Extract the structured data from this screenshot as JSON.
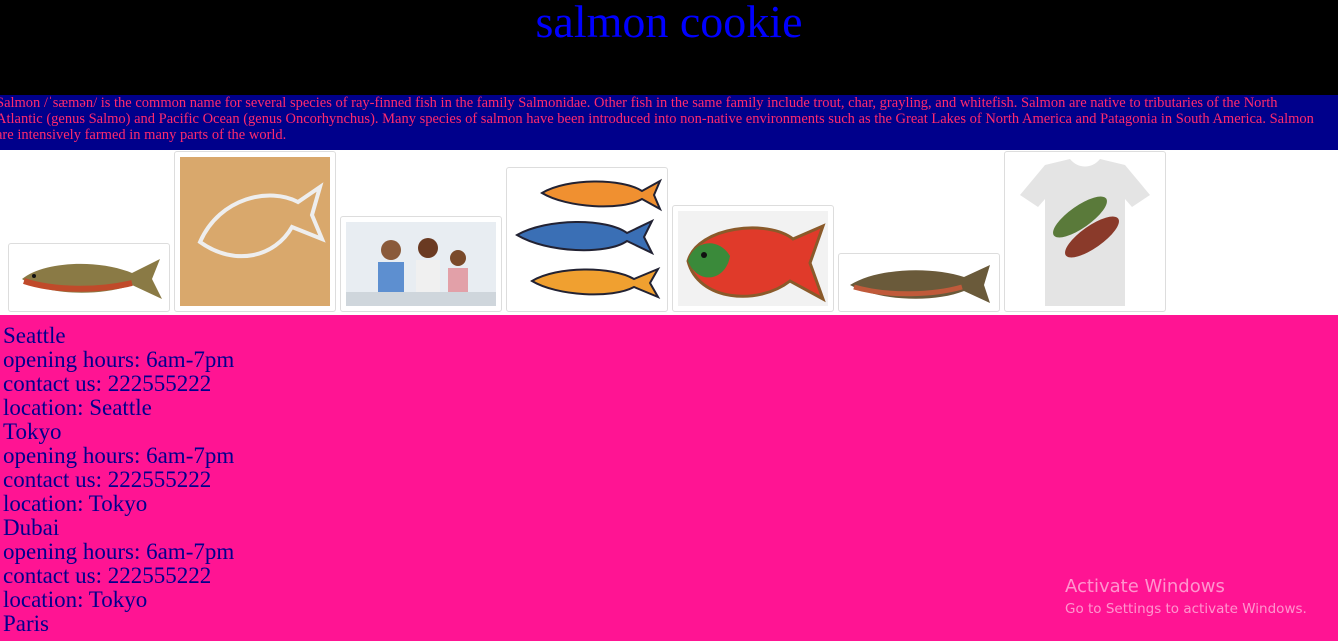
{
  "header": {
    "title": "salmon cookie"
  },
  "intro": {
    "text": "Salmon /ˈsæmən/ is the common name for several species of ray-finned fish in the family Salmonidae. Other fish in the same family include trout, char, grayling, and whitefish. Salmon are native to tributaries of the North Atlantic (genus Salmo) and Pacific Ocean (genus Oncorhynchus). Many species of salmon have been introduced into non-native environments such as the Great Lakes of North America and Patagonia in South America. Salmon are intensively farmed in many parts of the world."
  },
  "gallery": {
    "images": [
      {
        "icon": "salmon-fish-image"
      },
      {
        "icon": "salmon-cookie-cutter-image"
      },
      {
        "icon": "family-kitchen-image"
      },
      {
        "icon": "cartoon-fish-image"
      },
      {
        "icon": "salmon-cookie-image"
      },
      {
        "icon": "salmon-side-image"
      },
      {
        "icon": "salmon-tshirt-image"
      }
    ]
  },
  "stores": [
    {
      "name": "Seattle",
      "hours": "opening hours: 6am-7pm",
      "contact": "contact us: 222555222",
      "location": "location: Seattle"
    },
    {
      "name": "Tokyo",
      "hours": "opening hours: 6am-7pm",
      "contact": "contact us: 222555222",
      "location": "location: Tokyo"
    },
    {
      "name": "Dubai",
      "hours": "opening hours: 6am-7pm",
      "contact": "contact us: 222555222",
      "location": "location: Tokyo"
    },
    {
      "name": "Paris"
    }
  ],
  "watermark": {
    "title": "Activate Windows",
    "subtitle": "Go to Settings to activate Windows."
  },
  "colors": {
    "header_bg": "#000000",
    "title": "#0000ff",
    "intro_bg": "#00008b",
    "intro_text": "#ff2a6d",
    "body_bg": "#ff1493",
    "store_text": "#00008b"
  }
}
